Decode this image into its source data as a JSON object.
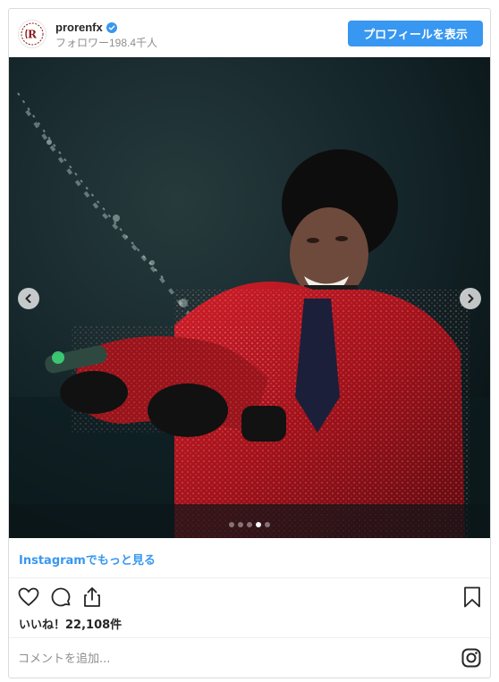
{
  "header": {
    "username": "prorenfx",
    "followers": "フォロワー198.4千人",
    "profile_button": "プロフィールを表示",
    "avatar_icon": "prorenfx-logo-icon"
  },
  "carousel": {
    "slide_count": 5,
    "active_index": 3
  },
  "view_more": "Instagramでもっと見る",
  "likes": "いいね！22,108件",
  "comment": {
    "placeholder": "コメントを追加..."
  },
  "colors": {
    "accent": "#3897f0",
    "suit_red": "#b3121c"
  }
}
